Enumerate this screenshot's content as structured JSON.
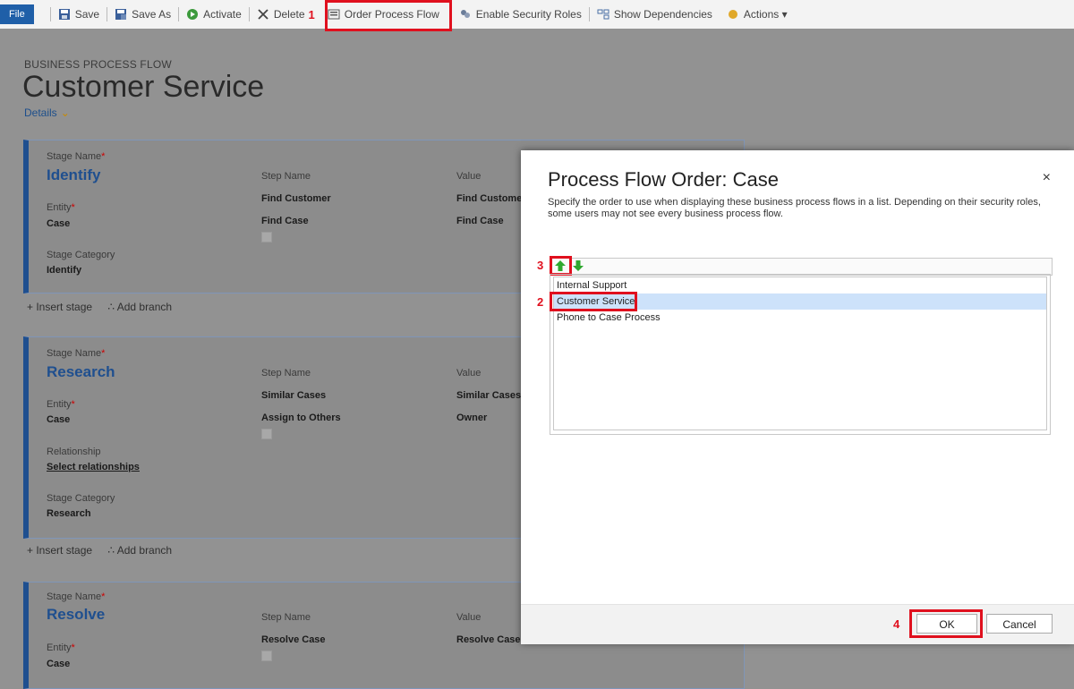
{
  "toolbar": {
    "file": "File",
    "save": "Save",
    "save_as": "Save As",
    "activate": "Activate",
    "delete": "Delete",
    "order_process_flow": "Order Process Flow",
    "enable_security_roles": "Enable Security Roles",
    "show_dependencies": "Show Dependencies",
    "actions": "Actions ▾"
  },
  "annotations": {
    "n1": "1",
    "n2": "2",
    "n3": "3",
    "n4": "4"
  },
  "page": {
    "crumb": "BUSINESS PROCESS FLOW",
    "title": "Customer Service",
    "details": "Details",
    "details_chevron": "⌄"
  },
  "labels": {
    "stage_name": "Stage Name",
    "required": "*",
    "step_name": "Step Name",
    "value": "Value",
    "entity": "Entity",
    "stage_category": "Stage Category",
    "relationship": "Relationship",
    "insert_stage": "+ Insert stage",
    "add_branch": "Add branch"
  },
  "stages": [
    {
      "name": "Identify",
      "entity": "Case",
      "category": "Identify",
      "steps": [
        {
          "step": "Find Customer",
          "value": "Find Custome"
        },
        {
          "step": "Find Case",
          "value": "Find Case"
        }
      ]
    },
    {
      "name": "Research",
      "entity": "Case",
      "relationship": "Select relationships",
      "category": "Research",
      "steps": [
        {
          "step": "Similar Cases",
          "value": "Similar Cases"
        },
        {
          "step": "Assign to Others",
          "value": "Owner"
        }
      ]
    },
    {
      "name": "Resolve",
      "entity": "Case",
      "steps": [
        {
          "step": "Resolve Case",
          "value": "Resolve Case"
        }
      ]
    }
  ],
  "dialog": {
    "title": "Process Flow Order: Case",
    "close": "×",
    "description": "Specify the order to use when displaying these business process flows in a list. Depending on their security roles, some users may not see every business process flow.",
    "items": [
      "Internal Support",
      "Customer Service",
      "Phone to Case Process"
    ],
    "selected_index": 1,
    "ok": "OK",
    "cancel": "Cancel"
  },
  "colors": {
    "accent": "#1f4f8f",
    "highlight": "#e0101e",
    "selection": "#cde2fa"
  }
}
